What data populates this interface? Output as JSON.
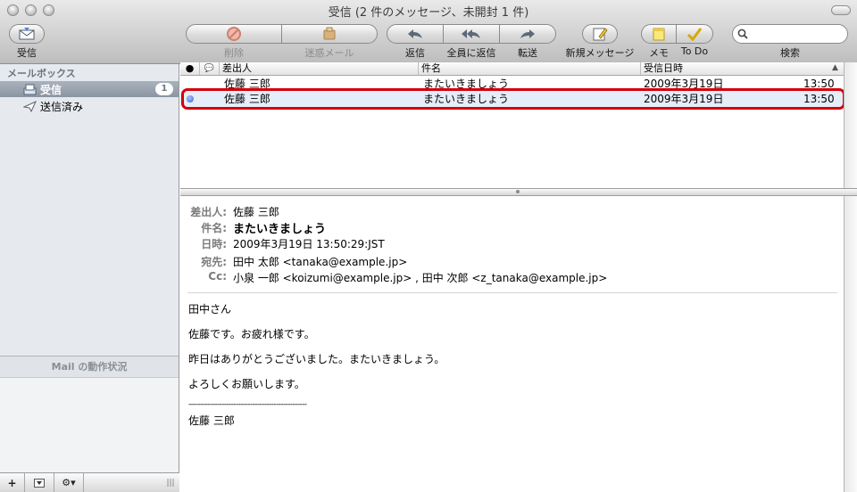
{
  "window": {
    "title": "受信 (2 件のメッセージ、未開封 1 件)"
  },
  "toolbar": {
    "get_mail": "受信",
    "delete": "削除",
    "junk": "迷惑メール",
    "reply": "返信",
    "reply_all": "全員に返信",
    "forward": "転送",
    "new_message": "新規メッセージ",
    "note": "メモ",
    "todo": "To Do",
    "search_label": "検索",
    "search_value": ""
  },
  "sidebar": {
    "section_title": "メールボックス",
    "items": [
      {
        "label": "受信",
        "badge": "1",
        "icon": "inbox-tray-icon",
        "selected": true
      },
      {
        "label": "送信済み",
        "icon": "paper-plane-icon",
        "selected": false
      }
    ],
    "activity_title": "Mail の動作状況",
    "footer": {
      "add": "+",
      "gear": "⚙▾",
      "resize": "|||"
    }
  },
  "message_list": {
    "columns": {
      "unread": "●",
      "reply": "💬",
      "from": "差出人",
      "subject": "件名",
      "date": "受信日時",
      "sort": "▲"
    },
    "rows": [
      {
        "unread": false,
        "from": "佐藤 三郎",
        "subject": "またいきましょう",
        "date": "2009年3月19日",
        "time": "13:50"
      },
      {
        "unread": true,
        "from": "佐藤 三郎",
        "subject": "またいきましょう",
        "date": "2009年3月19日",
        "time": "13:50"
      }
    ]
  },
  "reader": {
    "headers": {
      "from_label": "差出人:",
      "from": "佐藤 三郎",
      "subject_label": "件名:",
      "subject": "またいきましょう",
      "date_label": "日時:",
      "date": "2009年3月19日 13:50:29:JST",
      "to_label": "宛先:",
      "to": "田中 太郎 <tanaka@example.jp>",
      "cc_label": "Cc:",
      "cc": "小泉 一郎 <koizumi@example.jp> , 田中 次郎 <z_tanaka@example.jp>"
    },
    "body": [
      "田中さん",
      "佐藤です。お疲れ様です。",
      "昨日はありがとうございました。またいきましょう。",
      "よろしくお願いします。",
      "--------------------------------------------------",
      "佐藤 三郎"
    ]
  },
  "colors": {
    "highlight_ring": "#d4000b",
    "selection_blue": "#e5edf8",
    "unread_dot": "#4a74d8"
  }
}
